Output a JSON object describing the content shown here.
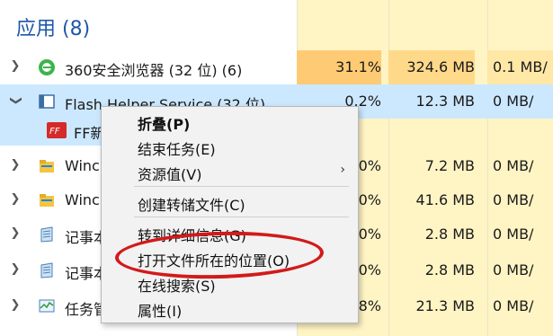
{
  "group": {
    "title": "应用 (8)"
  },
  "rows": [
    {
      "name": "360安全浏览器 (32 位) (6)",
      "cpu": "31.1%",
      "mem": "324.6 MB",
      "disk": "0.1 MB/"
    },
    {
      "name": "Flash Helper Service (32 位)",
      "cpu": "0.2%",
      "mem": "12.3 MB",
      "disk": "0 MB/"
    },
    {
      "name": "FF新",
      "cpu": "",
      "mem": "",
      "disk": ""
    },
    {
      "name": "Winc",
      "cpu": "0%",
      "mem": "7.2 MB",
      "disk": "0 MB/"
    },
    {
      "name": "Winc",
      "cpu": "0%",
      "mem": "41.6 MB",
      "disk": "0 MB/"
    },
    {
      "name": "记事本",
      "cpu": "0%",
      "mem": "2.8 MB",
      "disk": "0 MB/"
    },
    {
      "name": "记事本",
      "cpu": "0%",
      "mem": "2.8 MB",
      "disk": "0 MB/"
    },
    {
      "name": "任务管",
      "cpu": "8%",
      "mem": "21.3 MB",
      "disk": "0 MB/"
    }
  ],
  "menu": {
    "items": [
      "折叠(P)",
      "结束任务(E)",
      "资源值(V)",
      "创建转储文件(C)",
      "转到详细信息(G)",
      "打开文件所在的位置(O)",
      "在线搜索(S)",
      "属性(I)"
    ]
  },
  "colors": {
    "accent": "#1f58a8",
    "selected": "#cce8ff",
    "highlight": "#d21a1a"
  }
}
